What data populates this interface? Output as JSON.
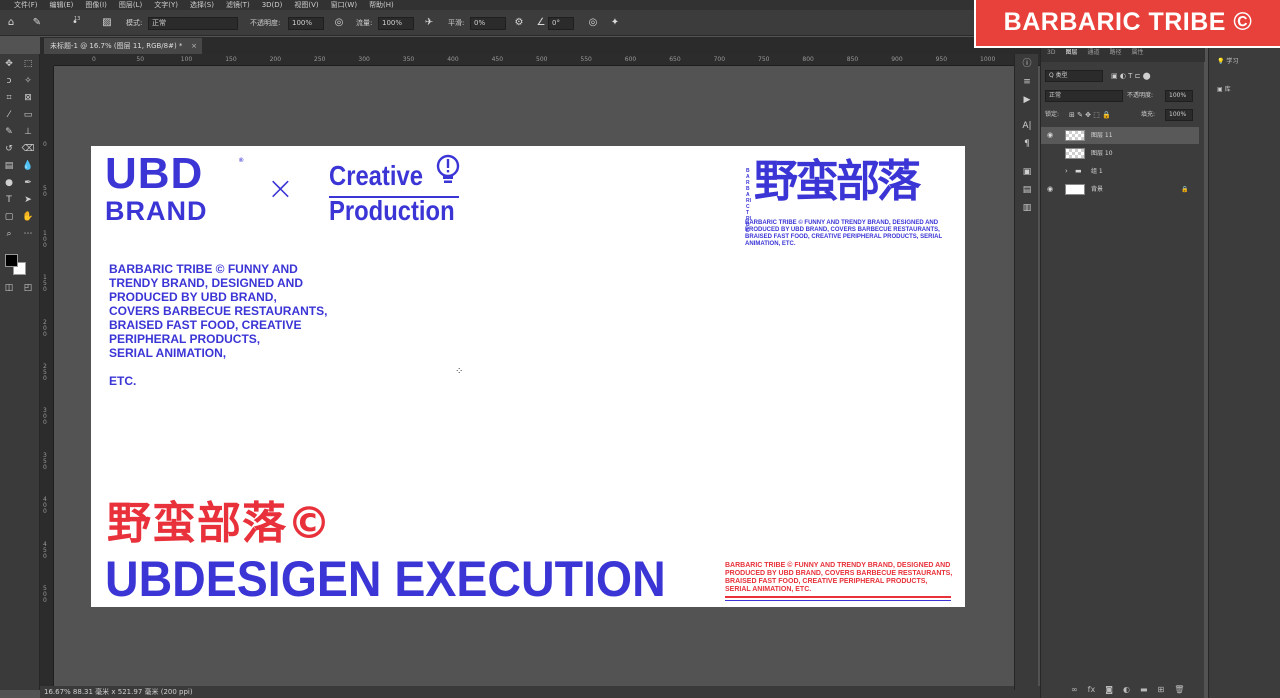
{
  "menu": [
    "文件(F)",
    "编辑(E)",
    "图像(I)",
    "图层(L)",
    "文字(Y)",
    "选择(S)",
    "滤镜(T)",
    "3D(D)",
    "视图(V)",
    "窗口(W)",
    "帮助(H)"
  ],
  "options": {
    "mode_label": "模式:",
    "mode_value": "正常",
    "opacity_label": "不透明度:",
    "opacity_value": "100%",
    "flow_label": "流量:",
    "flow_value": "100%",
    "smooth_label": "平滑:",
    "smooth_value": "0%",
    "angle_value": "0°",
    "brush_size": "13"
  },
  "document_tab": {
    "title": "未标题-1 @ 16.7% (图层 11, RGB/8#) *",
    "close": "×"
  },
  "ruler": {
    "top_ticks": [
      "0",
      "50",
      "100",
      "150",
      "200",
      "250",
      "300",
      "350",
      "400",
      "450",
      "500",
      "550",
      "600",
      "650",
      "700",
      "750",
      "800",
      "850",
      "900",
      "950",
      "1000"
    ],
    "left_ticks": [
      "0",
      "5\n0",
      "1\n0\n0",
      "1\n5\n0",
      "2\n0\n0",
      "2\n5\n0",
      "3\n0\n0",
      "3\n5\n0",
      "4\n0\n0",
      "4\n5\n0",
      "5\n0\n0"
    ]
  },
  "artboard": {
    "ubd_line1": "UBD",
    "ubd_line2": "BRAND",
    "ubd_reg": "®",
    "times": "×",
    "creative_line1": "Creative",
    "creative_line2": "Production",
    "intro": "BARBARIC TRIBE © FUNNY AND\nTRENDY BRAND, DESIGNED AND\nPRODUCED BY UBD BRAND,\nCOVERS BARBECUE RESTAURANTS,\nBRAISED FAST FOOD, CREATIVE\nPERIPHERAL PRODUCTS,\nSERIAL ANIMATION,\n\nETC.",
    "logo_vertical": "BARBARICTRIBE",
    "logo_cn": "野蛮部落",
    "logo_desc": "BARBARIC TRIBE © FUNNY AND TRENDY BRAND, DESIGNED AND PRODUCED BY UBD BRAND, COVERS BARBECUE RESTAURANTS, BRAISED FAST FOOD, CREATIVE PERIPHERAL PRODUCTS, SERIAL ANIMATION, ETC.",
    "cn_title": "野蛮部落©",
    "execution": "UBDESIGEN  EXECUTION",
    "bottom_desc": "BARBARIC TRIBE © FUNNY AND TRENDY BRAND, DESIGNED AND PRODUCED BY UBD BRAND, COVERS BARBECUE RESTAURANTS, BRAISED FAST FOOD, CREATIVE PERIPHERAL PRODUCTS, SERIAL ANIMATION, ETC."
  },
  "status": "16.67%   88.31 毫米 x 521.97 毫米 (200 ppi)",
  "layers_panel": {
    "tabs": [
      "3D",
      "图层",
      "通道",
      "路径",
      "属性"
    ],
    "filter_label": "Q 类型",
    "blend_mode": "正常",
    "opacity_label": "不透明度:",
    "opacity_value": "100%",
    "lock_label": "锁定:",
    "fill_label": "填充:",
    "fill_value": "100%",
    "layers": [
      {
        "name": "图层 11",
        "visible": true,
        "selected": true
      },
      {
        "name": "图层 10",
        "visible": false,
        "selected": false
      },
      {
        "name": "组 1",
        "visible": false,
        "selected": false,
        "group": true
      },
      {
        "name": "背景",
        "visible": true,
        "selected": false,
        "locked": true
      }
    ]
  },
  "right_panel": {
    "learn": "学习",
    "library": "库"
  },
  "banner": "BARBARIC TRIBE ©",
  "colors": {
    "brand_blue": "#3b35d6",
    "brand_red": "#e8313a",
    "banner_bg": "#e8403a"
  }
}
